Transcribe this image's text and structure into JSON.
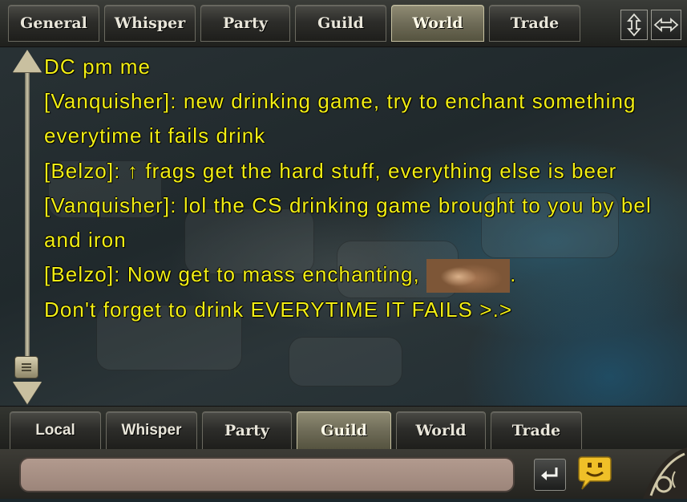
{
  "top_tabs": [
    {
      "label": "General",
      "active": false
    },
    {
      "label": "Whisper",
      "active": false
    },
    {
      "label": "Party",
      "active": false
    },
    {
      "label": "Guild",
      "active": false
    },
    {
      "label": "World",
      "active": true
    },
    {
      "label": "Trade",
      "active": false
    }
  ],
  "window_controls": {
    "resize_vertical_icon": "resize-vertical-icon",
    "resize_horizontal_icon": "resize-horizontal-icon"
  },
  "messages": [
    {
      "text": "DC pm me"
    },
    {
      "text": "[Vanquisher]:  new drinking game, try to enchant something everytime it fails drink"
    },
    {
      "text": "[Belzo]:  ↑ frags get the hard stuff, everything else is beer"
    },
    {
      "text": "[Vanquisher]:  lol the CS drinking game brought to you by bel and iron"
    },
    {
      "before": "[Belzo]:  Now get to mass enchanting, ",
      "emote": "groundhog-emote",
      "after": "."
    },
    {
      "text": "Don't forget to drink EVERYTIME IT FAILS >.>"
    }
  ],
  "bottom_tabs": [
    {
      "label": "Local",
      "active": false
    },
    {
      "label": "Whisper",
      "active": false
    },
    {
      "label": "Party",
      "active": false
    },
    {
      "label": "Guild",
      "active": true
    },
    {
      "label": "World",
      "active": false
    },
    {
      "label": "Trade",
      "active": false
    }
  ],
  "input": {
    "value": "",
    "placeholder": ""
  },
  "icons": {
    "send": "return-arrow-icon",
    "emote": "speech-bubble-smiley-icon",
    "scroll_up": "scroll-up-arrow-icon",
    "scroll_down": "scroll-down-arrow-icon"
  },
  "colors": {
    "message_text": "#f2ee14",
    "active_tab": "#8f8b73",
    "input_background": "#b29a8e"
  }
}
